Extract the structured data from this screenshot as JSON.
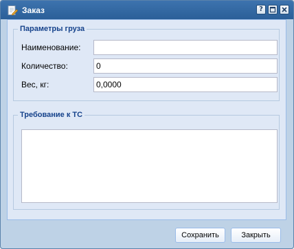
{
  "window": {
    "title": "Заказ",
    "icon": "edit-document-icon"
  },
  "title_buttons": {
    "help": "?",
    "maximize": "maximize-icon",
    "close": "close-icon"
  },
  "cargo": {
    "legend": "Параметры груза",
    "name_label": "Наименование:",
    "name_value": "",
    "quantity_label": "Количество:",
    "quantity_value": "0",
    "weight_label": "Вес, кг:",
    "weight_value": "0,0000"
  },
  "vehicle": {
    "legend": "Требование к ТС",
    "requirements_value": ""
  },
  "buttons": {
    "save": "Сохранить",
    "close": "Закрыть"
  },
  "colors": {
    "titlebar": "#2b5f98",
    "panel": "#dfe8f6",
    "legend_text": "#15428b",
    "frame": "#bed2e6"
  }
}
